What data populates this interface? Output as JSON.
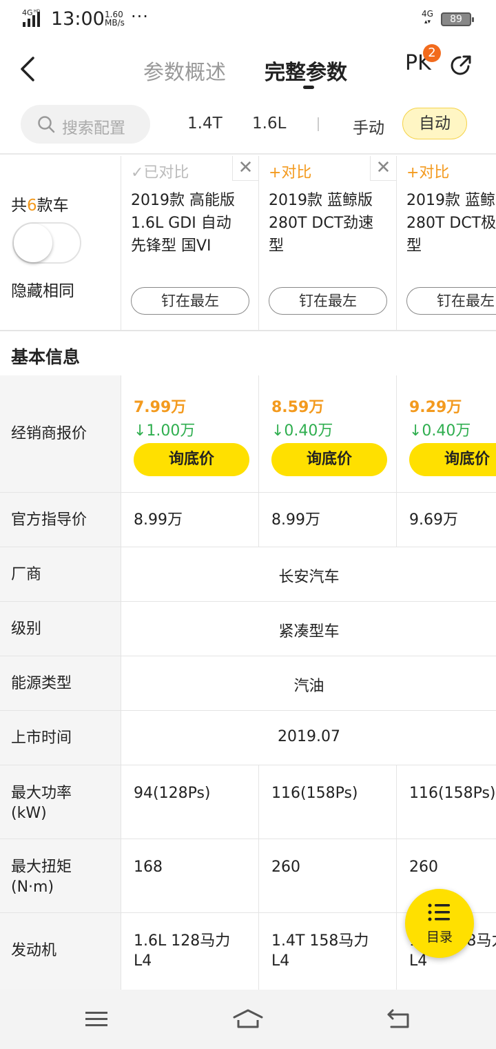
{
  "status_bar": {
    "network": "4G",
    "network_sup": "HD",
    "time": "13:00",
    "speed_value": "1.60",
    "speed_unit": "MB/s",
    "more": "···",
    "net_type": "4G",
    "battery": "89"
  },
  "header": {
    "tab_overview": "参数概述",
    "tab_full": "完整参数",
    "pk_label": "PK",
    "pk_count": "2"
  },
  "filter": {
    "search_placeholder": "搜索配置",
    "chips": [
      "1.4T",
      "1.6L",
      "手动",
      "自动"
    ],
    "selected_chip": "自动"
  },
  "car_header": {
    "count_prefix": "共",
    "count": "6",
    "count_suffix": "款车",
    "hide_same_label": "隐藏相同",
    "hide_same_on": false,
    "cars": [
      {
        "compare": "✓已对比",
        "compared": true,
        "name": "2019款 高能版\n1.6L GDI 自动\n先锋型 国VI",
        "pin": "钉在最左"
      },
      {
        "compare": "+对比",
        "compared": false,
        "name": "2019款 蓝鲸版\n280T DCT劲速\n型",
        "pin": "钉在最左"
      },
      {
        "compare": "+对比",
        "compared": false,
        "name": "2019款 蓝鲸\n280T DCT极\n型",
        "pin": "钉在最左"
      }
    ]
  },
  "section": {
    "title": "基本信息"
  },
  "rows": {
    "dealer_price": {
      "label": "经销商报价",
      "cells": [
        {
          "price": "7.99万",
          "drop": "↓1.00万",
          "button": "询底价"
        },
        {
          "price": "8.59万",
          "drop": "↓0.40万",
          "button": "询底价"
        },
        {
          "price": "9.29万",
          "drop": "↓0.40万",
          "button": "询底价"
        }
      ]
    },
    "official_price": {
      "label": "官方指导价",
      "values": [
        "8.99万",
        "8.99万",
        "9.69万"
      ]
    },
    "manufacturer": {
      "label": "厂商",
      "value": "长安汽车"
    },
    "level": {
      "label": "级别",
      "value": "紧凑型车"
    },
    "energy": {
      "label": "能源类型",
      "value": "汽油"
    },
    "launch": {
      "label": "上市时间",
      "value": "2019.07"
    },
    "power": {
      "label": "最大功率\n(kW)",
      "values": [
        "94(128Ps)",
        "116(158Ps)",
        "116(158Ps)"
      ]
    },
    "torque": {
      "label": "最大扭矩\n(N·m)",
      "values": [
        "168",
        "260",
        "260"
      ]
    },
    "engine": {
      "label": "发动机",
      "values": [
        "1.6L 128马力\nL4",
        "1.4T 158马力\nL4",
        "1.4T 158马力\nL4"
      ]
    }
  },
  "catalog": {
    "label": "目录"
  },
  "colors": {
    "accent_yellow": "#ffe000",
    "price_orange": "#f39a1e",
    "drop_green": "#2fae4f",
    "badge_orange": "#f26b1d"
  }
}
